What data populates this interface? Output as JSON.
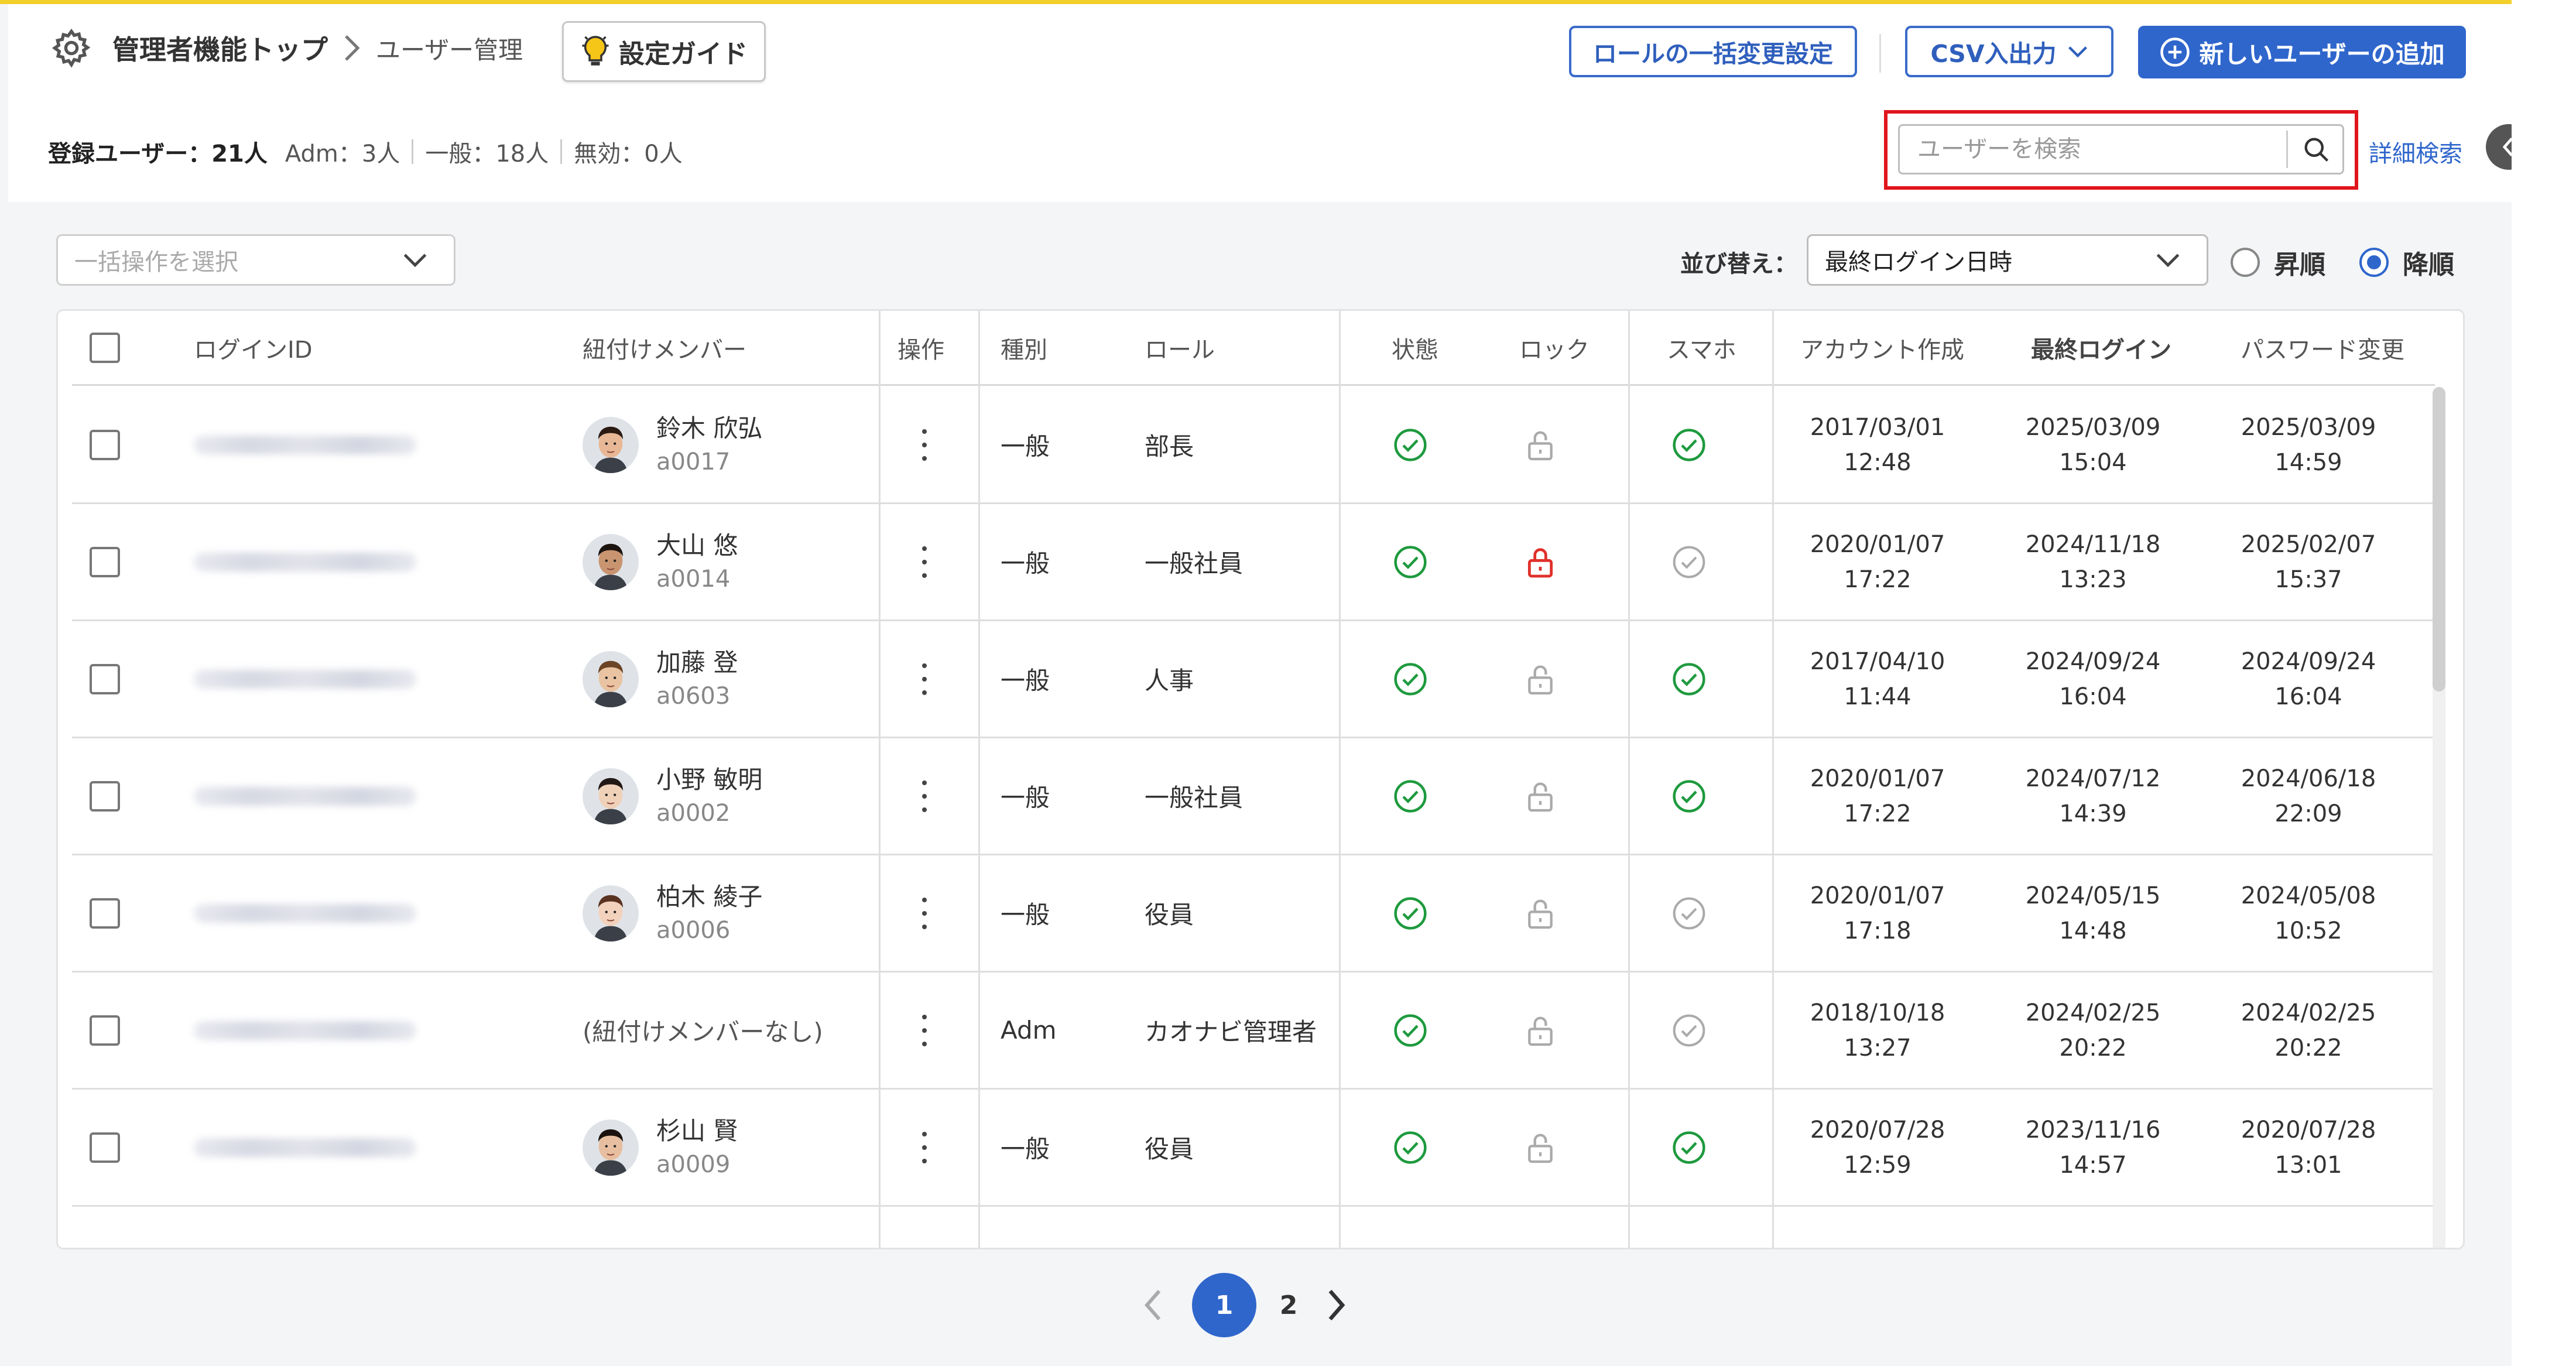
{
  "header": {
    "home_label": "管理者機能トップ",
    "current_page": "ユーザー管理",
    "guide_label": "設定ガイド",
    "role_bulk_label": "ロールの一括変更設定",
    "csv_label": "CSV入出力",
    "add_user_label": "新しいユーザーの追加"
  },
  "summary": {
    "total_label": "登録ユーザー：21人",
    "adm": "Adm：3人",
    "general": "一般：18人",
    "invalid": "無効：0人"
  },
  "search": {
    "placeholder": "ユーザーを検索",
    "advanced_label": "詳細検索"
  },
  "toolbar": {
    "bulk_placeholder": "一括操作を選択",
    "sort_label": "並び替え：",
    "sort_value": "最終ログイン日時",
    "asc_label": "昇順",
    "desc_label": "降順",
    "order": "desc"
  },
  "table": {
    "columns": {
      "login_id": "ログインID",
      "member": "紐付けメンバー",
      "action": "操作",
      "type": "種別",
      "role": "ロール",
      "status": "状態",
      "lock": "ロック",
      "mobile": "スマホ",
      "created": "アカウント作成",
      "last_login": "最終ログイン",
      "password_changed": "パスワード変更"
    },
    "rows": [
      {
        "member_name": "鈴木 欣弘",
        "member_id": "a0017",
        "type": "一般",
        "role": "部長",
        "status": "active",
        "locked": false,
        "mobile": true,
        "created_date": "2017/03/01",
        "created_time": "12:48",
        "login_date": "2025/03/09",
        "login_time": "15:04",
        "pw_date": "2025/03/09",
        "pw_time": "14:59",
        "avatar_skin": "#e8b896",
        "avatar_hair": "#2a1a12"
      },
      {
        "member_name": "大山 悠",
        "member_id": "a0014",
        "type": "一般",
        "role": "一般社員",
        "status": "active",
        "locked": true,
        "mobile": false,
        "created_date": "2020/01/07",
        "created_time": "17:22",
        "login_date": "2024/11/18",
        "login_time": "13:23",
        "pw_date": "2025/02/07",
        "pw_time": "15:37",
        "avatar_skin": "#c99470",
        "avatar_hair": "#1d1410"
      },
      {
        "member_name": "加藤 登",
        "member_id": "a0603",
        "type": "一般",
        "role": "人事",
        "status": "active",
        "locked": false,
        "mobile": true,
        "created_date": "2017/04/10",
        "created_time": "11:44",
        "login_date": "2024/09/24",
        "login_time": "16:04",
        "pw_date": "2024/09/24",
        "pw_time": "16:04",
        "avatar_skin": "#e9c3a2",
        "avatar_hair": "#6b4526"
      },
      {
        "member_name": "小野 敏明",
        "member_id": "a0002",
        "type": "一般",
        "role": "一般社員",
        "status": "active",
        "locked": false,
        "mobile": true,
        "created_date": "2020/01/07",
        "created_time": "17:22",
        "login_date": "2024/07/12",
        "login_time": "14:39",
        "pw_date": "2024/06/18",
        "pw_time": "22:09",
        "avatar_skin": "#efd1b8",
        "avatar_hair": "#221814"
      },
      {
        "member_name": "柏木 綾子",
        "member_id": "a0006",
        "type": "一般",
        "role": "役員",
        "status": "active",
        "locked": false,
        "mobile": false,
        "created_date": "2020/01/07",
        "created_time": "17:18",
        "login_date": "2024/05/15",
        "login_time": "14:48",
        "pw_date": "2024/05/08",
        "pw_time": "10:52",
        "avatar_skin": "#f3d2bd",
        "avatar_hair": "#5a3320"
      },
      {
        "member_name": "",
        "member_id": "",
        "no_member_label": "(紐付けメンバーなし)",
        "type": "Adm",
        "role": "カオナビ管理者",
        "status": "active",
        "locked": false,
        "mobile": false,
        "created_date": "2018/10/18",
        "created_time": "13:27",
        "login_date": "2024/02/25",
        "login_time": "20:22",
        "pw_date": "2024/02/25",
        "pw_time": "20:22"
      },
      {
        "member_name": "杉山 賢",
        "member_id": "a0009",
        "type": "一般",
        "role": "役員",
        "status": "active",
        "locked": false,
        "mobile": true,
        "created_date": "2020/07/28",
        "created_time": "12:59",
        "login_date": "2023/11/16",
        "login_time": "14:57",
        "pw_date": "2020/07/28",
        "pw_time": "13:01",
        "avatar_skin": "#e7bfa0",
        "avatar_hair": "#1a120e"
      }
    ]
  },
  "pagination": {
    "pages": [
      "1",
      "2"
    ],
    "current": "1"
  },
  "colors": {
    "accent": "#2f66cc",
    "top_line": "#f3cf2b",
    "check_green": "#1e9a3e",
    "lock_red": "#e0302a",
    "highlight_red": "#e0151c"
  }
}
